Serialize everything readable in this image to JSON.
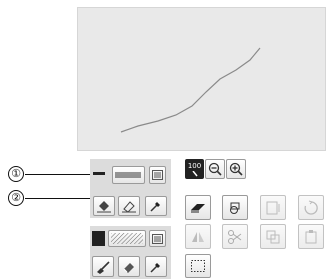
{
  "callouts": {
    "first": "①",
    "second": "②"
  },
  "zoom": {
    "level_label": "100"
  },
  "icons": {
    "line_type": "dashed-line-icon",
    "line_color": "pencil-color-icon",
    "line_property_list": "list-icon",
    "select_line": "bucket-select-icon",
    "erase_line": "eraser-icon",
    "eyedropper_line": "eyedropper-icon",
    "fill_pattern": "hatch-pattern-icon",
    "fill_color": "fill-color-icon",
    "fill_property_list": "list-icon",
    "fill_brush": "brush-icon",
    "erase_fill": "fill-eraser-icon",
    "eyedropper_fill": "eyedropper-icon",
    "zoom_out": "zoom-out-icon",
    "zoom_in": "zoom-in-icon",
    "eraser": "eraser-icon",
    "shape_select": "shape-select-icon",
    "size": "resize-icon",
    "rotate": "rotate-icon",
    "flip": "flip-icon",
    "cut": "scissors-icon",
    "copy": "copy-icon",
    "paste": "paste-icon",
    "select_area": "dotted-select-icon"
  },
  "colors": {
    "canvas": "#e9e9e9",
    "stroke": "#8a8a8a",
    "panel": "#dcdcdc",
    "line_color_swatch": "#222222"
  }
}
